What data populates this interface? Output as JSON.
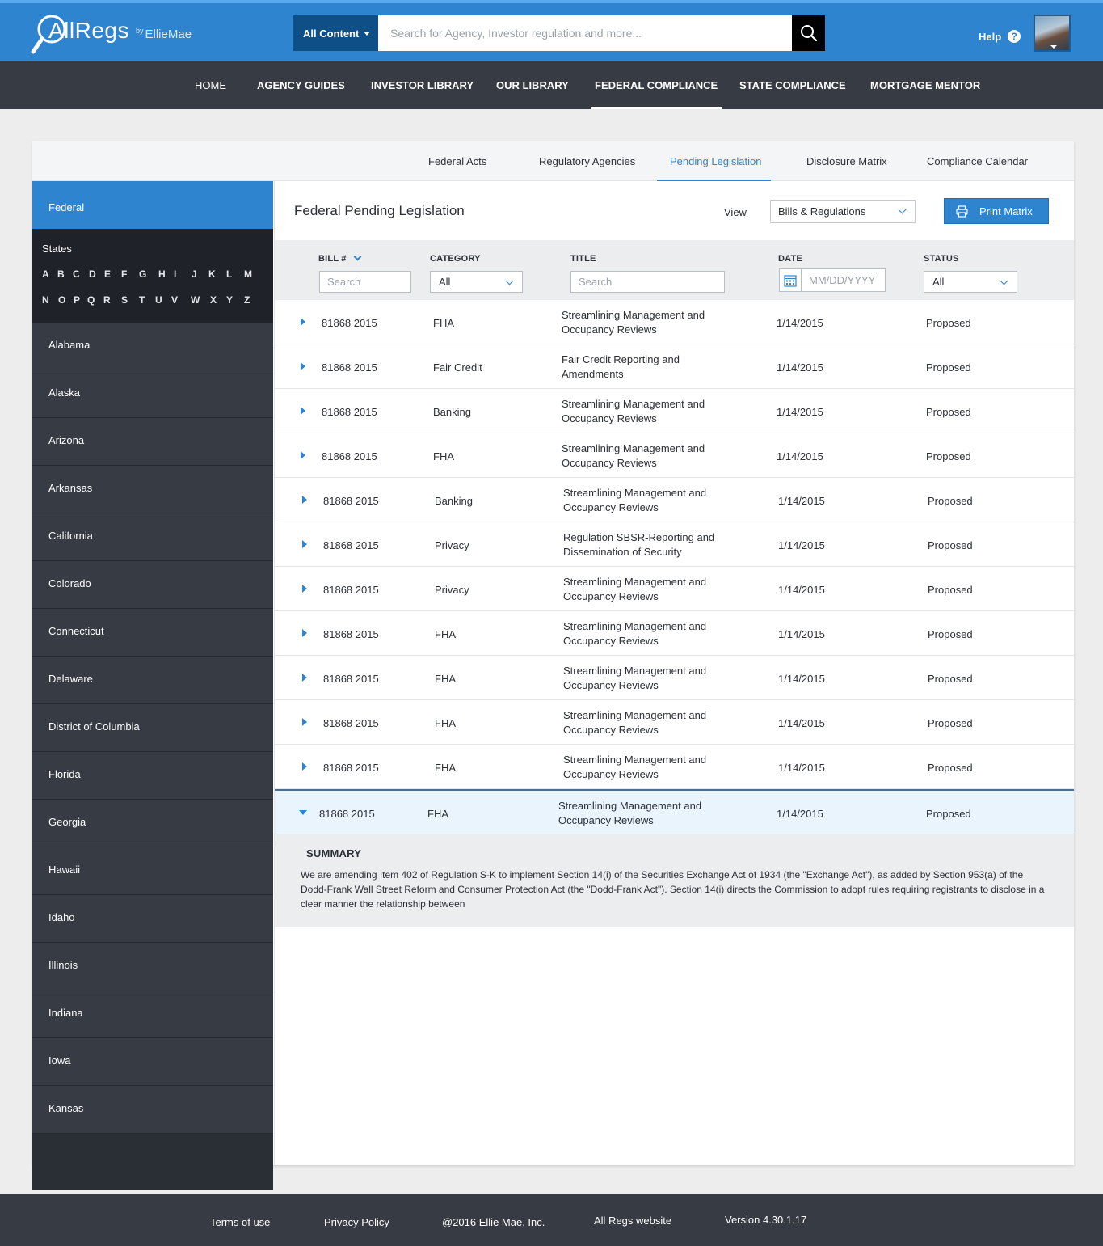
{
  "header": {
    "logo_text": "AllRegs",
    "logo_by": "by",
    "logo_brand": "EllieMae",
    "scope_label": "All Content",
    "search_placeholder": "Search for Agency, Investor regulation and more...",
    "help_label": "Help",
    "help_icon_glyph": "?"
  },
  "nav": {
    "home": "HOME",
    "agency": "AGENCY GUIDES",
    "investor": "INVESTOR LIBRARY",
    "our": "OUR LIBRARY",
    "federal": "FEDERAL COMPLIANCE",
    "state": "STATE COMPLIANCE",
    "mentor": "MORTGAGE MENTOR"
  },
  "subnav": {
    "acts": "Federal Acts",
    "agencies": "Regulatory Agencies",
    "pending": "Pending Legislation",
    "matrix": "Disclosure Matrix",
    "calendar": "Compliance Calendar"
  },
  "sidebar": {
    "federal": "Federal",
    "states_label": "States",
    "letters_row1": [
      "A",
      "B",
      "C",
      "D",
      "E",
      "F",
      "G",
      "H",
      "I",
      "J",
      "K",
      "L",
      "M"
    ],
    "letters_row2": [
      "N",
      "O",
      "P",
      "Q",
      "R",
      "S",
      "T",
      "U",
      "V",
      "W",
      "X",
      "Y",
      "Z"
    ],
    "states": [
      "Alabama",
      "Alaska",
      "Arizona",
      "Arkansas",
      "California",
      "Colorado",
      "Connecticut",
      "Delaware",
      "District of Columbia",
      "Florida",
      "Georgia",
      "Hawaii",
      "Idaho",
      "Illinois",
      "Indiana",
      "Iowa",
      "Kansas"
    ]
  },
  "content": {
    "title": "Federal Pending Legislation",
    "view_label": "View",
    "view_value": "Bills & Regulations",
    "print_label": "Print Matrix",
    "columns": {
      "bill": "BILL #",
      "category": "CATEGORY",
      "title": "TITLE",
      "date": "DATE",
      "status": "STATUS"
    },
    "filters": {
      "bill_placeholder": "Search",
      "category_value": "All",
      "title_placeholder": "Search",
      "date_placeholder": "MM/DD/YYYY",
      "status_value": "All"
    },
    "rows": [
      {
        "bill": "81868 2015",
        "category": "FHA",
        "title": "Streamlining Management and Occupancy Reviews",
        "date": "1/14/2015",
        "status": "Proposed"
      },
      {
        "bill": "81868 2015",
        "category": "Fair Credit",
        "title": "Fair Credit Reporting and Amendments",
        "date": "1/14/2015",
        "status": "Proposed"
      },
      {
        "bill": "81868 2015",
        "category": "Banking",
        "title": "Streamlining Management and Occupancy Reviews",
        "date": "1/14/2015",
        "status": "Proposed"
      },
      {
        "bill": "81868 2015",
        "category": "FHA",
        "title": "Streamlining Management and Occupancy Reviews",
        "date": "1/14/2015",
        "status": "Proposed"
      },
      {
        "bill": "81868 2015",
        "category": "Banking",
        "title": "Streamlining Management and Occupancy Reviews",
        "date": "1/14/2015",
        "status": "Proposed"
      },
      {
        "bill": "81868 2015",
        "category": "Privacy",
        "title": "Regulation SBSR-Reporting and Dissemination of Security",
        "date": "1/14/2015",
        "status": "Proposed"
      },
      {
        "bill": "81868 2015",
        "category": "Privacy",
        "title": "Streamlining Management and Occupancy Reviews",
        "date": "1/14/2015",
        "status": "Proposed"
      },
      {
        "bill": "81868 2015",
        "category": "FHA",
        "title": "Streamlining Management and Occupancy Reviews",
        "date": "1/14/2015",
        "status": "Proposed"
      },
      {
        "bill": "81868 2015",
        "category": "FHA",
        "title": "Streamlining Management and Occupancy Reviews",
        "date": "1/14/2015",
        "status": "Proposed"
      },
      {
        "bill": "81868 2015",
        "category": "FHA",
        "title": "Streamlining Management and Occupancy Reviews",
        "date": "1/14/2015",
        "status": "Proposed"
      },
      {
        "bill": "81868 2015",
        "category": "FHA",
        "title": "Streamlining Management and Occupancy Reviews",
        "date": "1/14/2015",
        "status": "Proposed"
      },
      {
        "bill": "81868 2015",
        "category": "FHA",
        "title": "Streamlining Management and Occupancy Reviews",
        "date": "1/14/2015",
        "status": "Proposed"
      }
    ],
    "summary_heading": "SUMMARY",
    "summary_text": "We are amending Item 402 of Regulation S-K to implement Section 14(i) of the Securities Exchange Act of 1934 (the \"Exchange Act\"), as added by Section 953(a) of the Dodd-Frank Wall Street Reform and Consumer Protection Act (the \"Dodd-Frank Act\"). Section 14(i) directs the Commission to adopt rules requiring registrants to disclose in a clear manner the relationship between"
  },
  "footer": {
    "terms": "Terms of use",
    "privacy": "Privacy Policy",
    "copyright": "@2016 Ellie Mae, Inc.",
    "website": "All Regs website",
    "version": "Version 4.30.1.17"
  },
  "colors": {
    "brand_blue": "#2f84d0",
    "nav_dark": "#363b44",
    "sidebar_dark": "#2a2e35"
  }
}
